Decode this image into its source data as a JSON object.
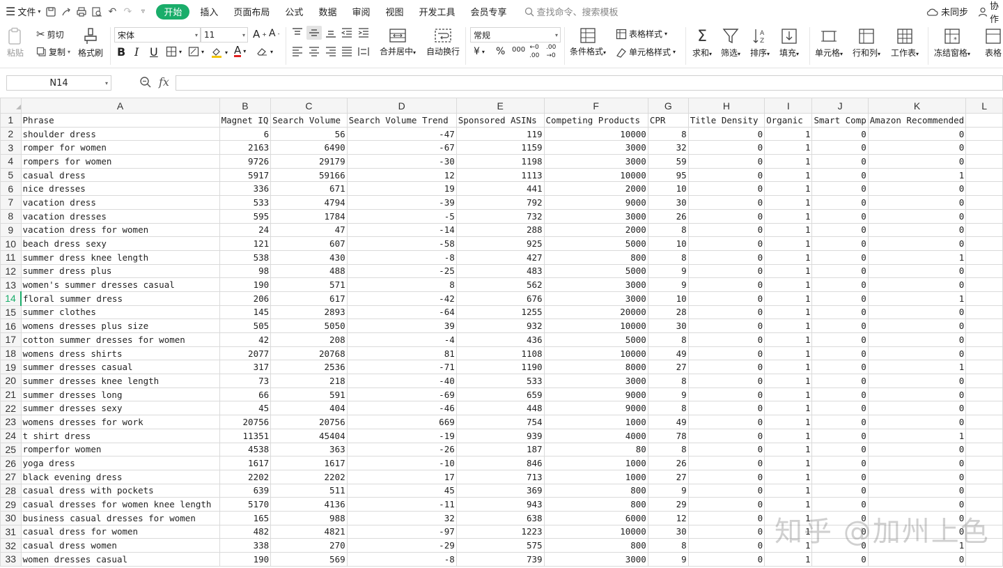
{
  "menubar": {
    "file_label": "文件",
    "tabs": [
      "开始",
      "插入",
      "页面布局",
      "公式",
      "数据",
      "审阅",
      "视图",
      "开发工具",
      "会员专享"
    ],
    "active_tab": "开始",
    "search_placeholder": "查找命令、搜索模板",
    "sync_label": "未同步",
    "collab_label": "协作"
  },
  "ribbon": {
    "paste": "粘贴",
    "cut": "剪切",
    "copy": "复制",
    "format_painter": "格式刷",
    "font_name": "宋体",
    "font_size": "11",
    "merge_center": "合并居中",
    "wrap_text": "自动换行",
    "number_format": "常规",
    "conditional_format": "条件格式",
    "table_style": "表格样式",
    "cell_style": "单元格样式",
    "sum": "求和",
    "filter": "筛选",
    "sort": "排序",
    "fill": "填充",
    "cell": "单元格",
    "row_col": "行和列",
    "worksheet": "工作表",
    "freeze": "冻结窗格",
    "table_tools": "表格"
  },
  "formula_bar": {
    "name_box": "N14",
    "fx_label": "fx",
    "formula": ""
  },
  "columns": [
    "A",
    "B",
    "C",
    "D",
    "E",
    "F",
    "G",
    "H",
    "I",
    "J",
    "K",
    "L"
  ],
  "active_row": "14",
  "rows": [
    [
      "1",
      "Phrase",
      "Magnet IQ",
      "Search Volume",
      "Search Volume Trend",
      "Sponsored ASINs",
      "Competing Products",
      "CPR",
      "Title Density",
      "Organic",
      "Smart Comp",
      "Amazon Recommended",
      ""
    ],
    [
      "2",
      "shoulder dress",
      "6",
      "56",
      "-47",
      "119",
      "10000",
      "8",
      "0",
      "1",
      "0",
      "0",
      ""
    ],
    [
      "3",
      "romper for women",
      "2163",
      "6490",
      "-67",
      "1159",
      "3000",
      "32",
      "0",
      "1",
      "0",
      "0",
      ""
    ],
    [
      "4",
      "rompers for women",
      "9726",
      "29179",
      "-30",
      "1198",
      "3000",
      "59",
      "0",
      "1",
      "0",
      "0",
      ""
    ],
    [
      "5",
      "casual dress",
      "5917",
      "59166",
      "12",
      "1113",
      "10000",
      "95",
      "0",
      "1",
      "0",
      "1",
      ""
    ],
    [
      "6",
      "nice dresses",
      "336",
      "671",
      "19",
      "441",
      "2000",
      "10",
      "0",
      "1",
      "0",
      "0",
      ""
    ],
    [
      "7",
      "vacation dress",
      "533",
      "4794",
      "-39",
      "792",
      "9000",
      "30",
      "0",
      "1",
      "0",
      "0",
      ""
    ],
    [
      "8",
      "vacation dresses",
      "595",
      "1784",
      "-5",
      "732",
      "3000",
      "26",
      "0",
      "1",
      "0",
      "0",
      ""
    ],
    [
      "9",
      "vacation dress for women",
      "24",
      "47",
      "-14",
      "288",
      "2000",
      "8",
      "0",
      "1",
      "0",
      "0",
      ""
    ],
    [
      "10",
      "beach dress sexy",
      "121",
      "607",
      "-58",
      "925",
      "5000",
      "10",
      "0",
      "1",
      "0",
      "0",
      ""
    ],
    [
      "11",
      "summer dress knee length",
      "538",
      "430",
      "-8",
      "427",
      "800",
      "8",
      "0",
      "1",
      "0",
      "1",
      ""
    ],
    [
      "12",
      "summer dress plus",
      "98",
      "488",
      "-25",
      "483",
      "5000",
      "9",
      "0",
      "1",
      "0",
      "0",
      ""
    ],
    [
      "13",
      "women's summer dresses casual",
      "190",
      "571",
      "8",
      "562",
      "3000",
      "9",
      "0",
      "1",
      "0",
      "0",
      ""
    ],
    [
      "14",
      "floral summer dress",
      "206",
      "617",
      "-42",
      "676",
      "3000",
      "10",
      "0",
      "1",
      "0",
      "1",
      ""
    ],
    [
      "15",
      "summer clothes",
      "145",
      "2893",
      "-64",
      "1255",
      "20000",
      "28",
      "0",
      "1",
      "0",
      "0",
      ""
    ],
    [
      "16",
      "womens dresses plus size",
      "505",
      "5050",
      "39",
      "932",
      "10000",
      "30",
      "0",
      "1",
      "0",
      "0",
      ""
    ],
    [
      "17",
      "cotton summer dresses for women",
      "42",
      "208",
      "-4",
      "436",
      "5000",
      "8",
      "0",
      "1",
      "0",
      "0",
      ""
    ],
    [
      "18",
      "womens dress shirts",
      "2077",
      "20768",
      "81",
      "1108",
      "10000",
      "49",
      "0",
      "1",
      "0",
      "0",
      ""
    ],
    [
      "19",
      "summer dresses casual",
      "317",
      "2536",
      "-71",
      "1190",
      "8000",
      "27",
      "0",
      "1",
      "0",
      "1",
      ""
    ],
    [
      "20",
      "summer dresses knee length",
      "73",
      "218",
      "-40",
      "533",
      "3000",
      "8",
      "0",
      "1",
      "0",
      "0",
      ""
    ],
    [
      "21",
      "summer dresses long",
      "66",
      "591",
      "-69",
      "659",
      "9000",
      "9",
      "0",
      "1",
      "0",
      "0",
      ""
    ],
    [
      "22",
      "summer dresses sexy",
      "45",
      "404",
      "-46",
      "448",
      "9000",
      "8",
      "0",
      "1",
      "0",
      "0",
      ""
    ],
    [
      "23",
      "womens dresses for work",
      "20756",
      "20756",
      "669",
      "754",
      "1000",
      "49",
      "0",
      "1",
      "0",
      "0",
      ""
    ],
    [
      "24",
      "t shirt dress",
      "11351",
      "45404",
      "-19",
      "939",
      "4000",
      "78",
      "0",
      "1",
      "0",
      "1",
      ""
    ],
    [
      "25",
      "romperfor women",
      "4538",
      "363",
      "-26",
      "187",
      "80",
      "8",
      "0",
      "1",
      "0",
      "0",
      ""
    ],
    [
      "26",
      "yoga dress",
      "1617",
      "1617",
      "-10",
      "846",
      "1000",
      "26",
      "0",
      "1",
      "0",
      "0",
      ""
    ],
    [
      "27",
      "black evening dress",
      "2202",
      "2202",
      "17",
      "713",
      "1000",
      "27",
      "0",
      "1",
      "0",
      "0",
      ""
    ],
    [
      "28",
      "casual dress with pockets",
      "639",
      "511",
      "45",
      "369",
      "800",
      "9",
      "0",
      "1",
      "0",
      "0",
      ""
    ],
    [
      "29",
      "casual dresses for women knee length",
      "5170",
      "4136",
      "-11",
      "943",
      "800",
      "29",
      "0",
      "1",
      "0",
      "0",
      ""
    ],
    [
      "30",
      "business casual dresses for women",
      "165",
      "988",
      "32",
      "638",
      "6000",
      "12",
      "0",
      "1",
      "0",
      "0",
      ""
    ],
    [
      "31",
      "casual dress for women",
      "482",
      "4821",
      "-97",
      "1223",
      "10000",
      "30",
      "0",
      "1",
      "0",
      "0",
      ""
    ],
    [
      "32",
      "casual dress women",
      "338",
      "270",
      "-29",
      "575",
      "800",
      "8",
      "0",
      "1",
      "0",
      "1",
      ""
    ],
    [
      "33",
      "women dresses casual",
      "190",
      "569",
      "-8",
      "739",
      "3000",
      "9",
      "0",
      "1",
      "0",
      "0",
      ""
    ]
  ],
  "watermark": "知乎 @加州上色"
}
